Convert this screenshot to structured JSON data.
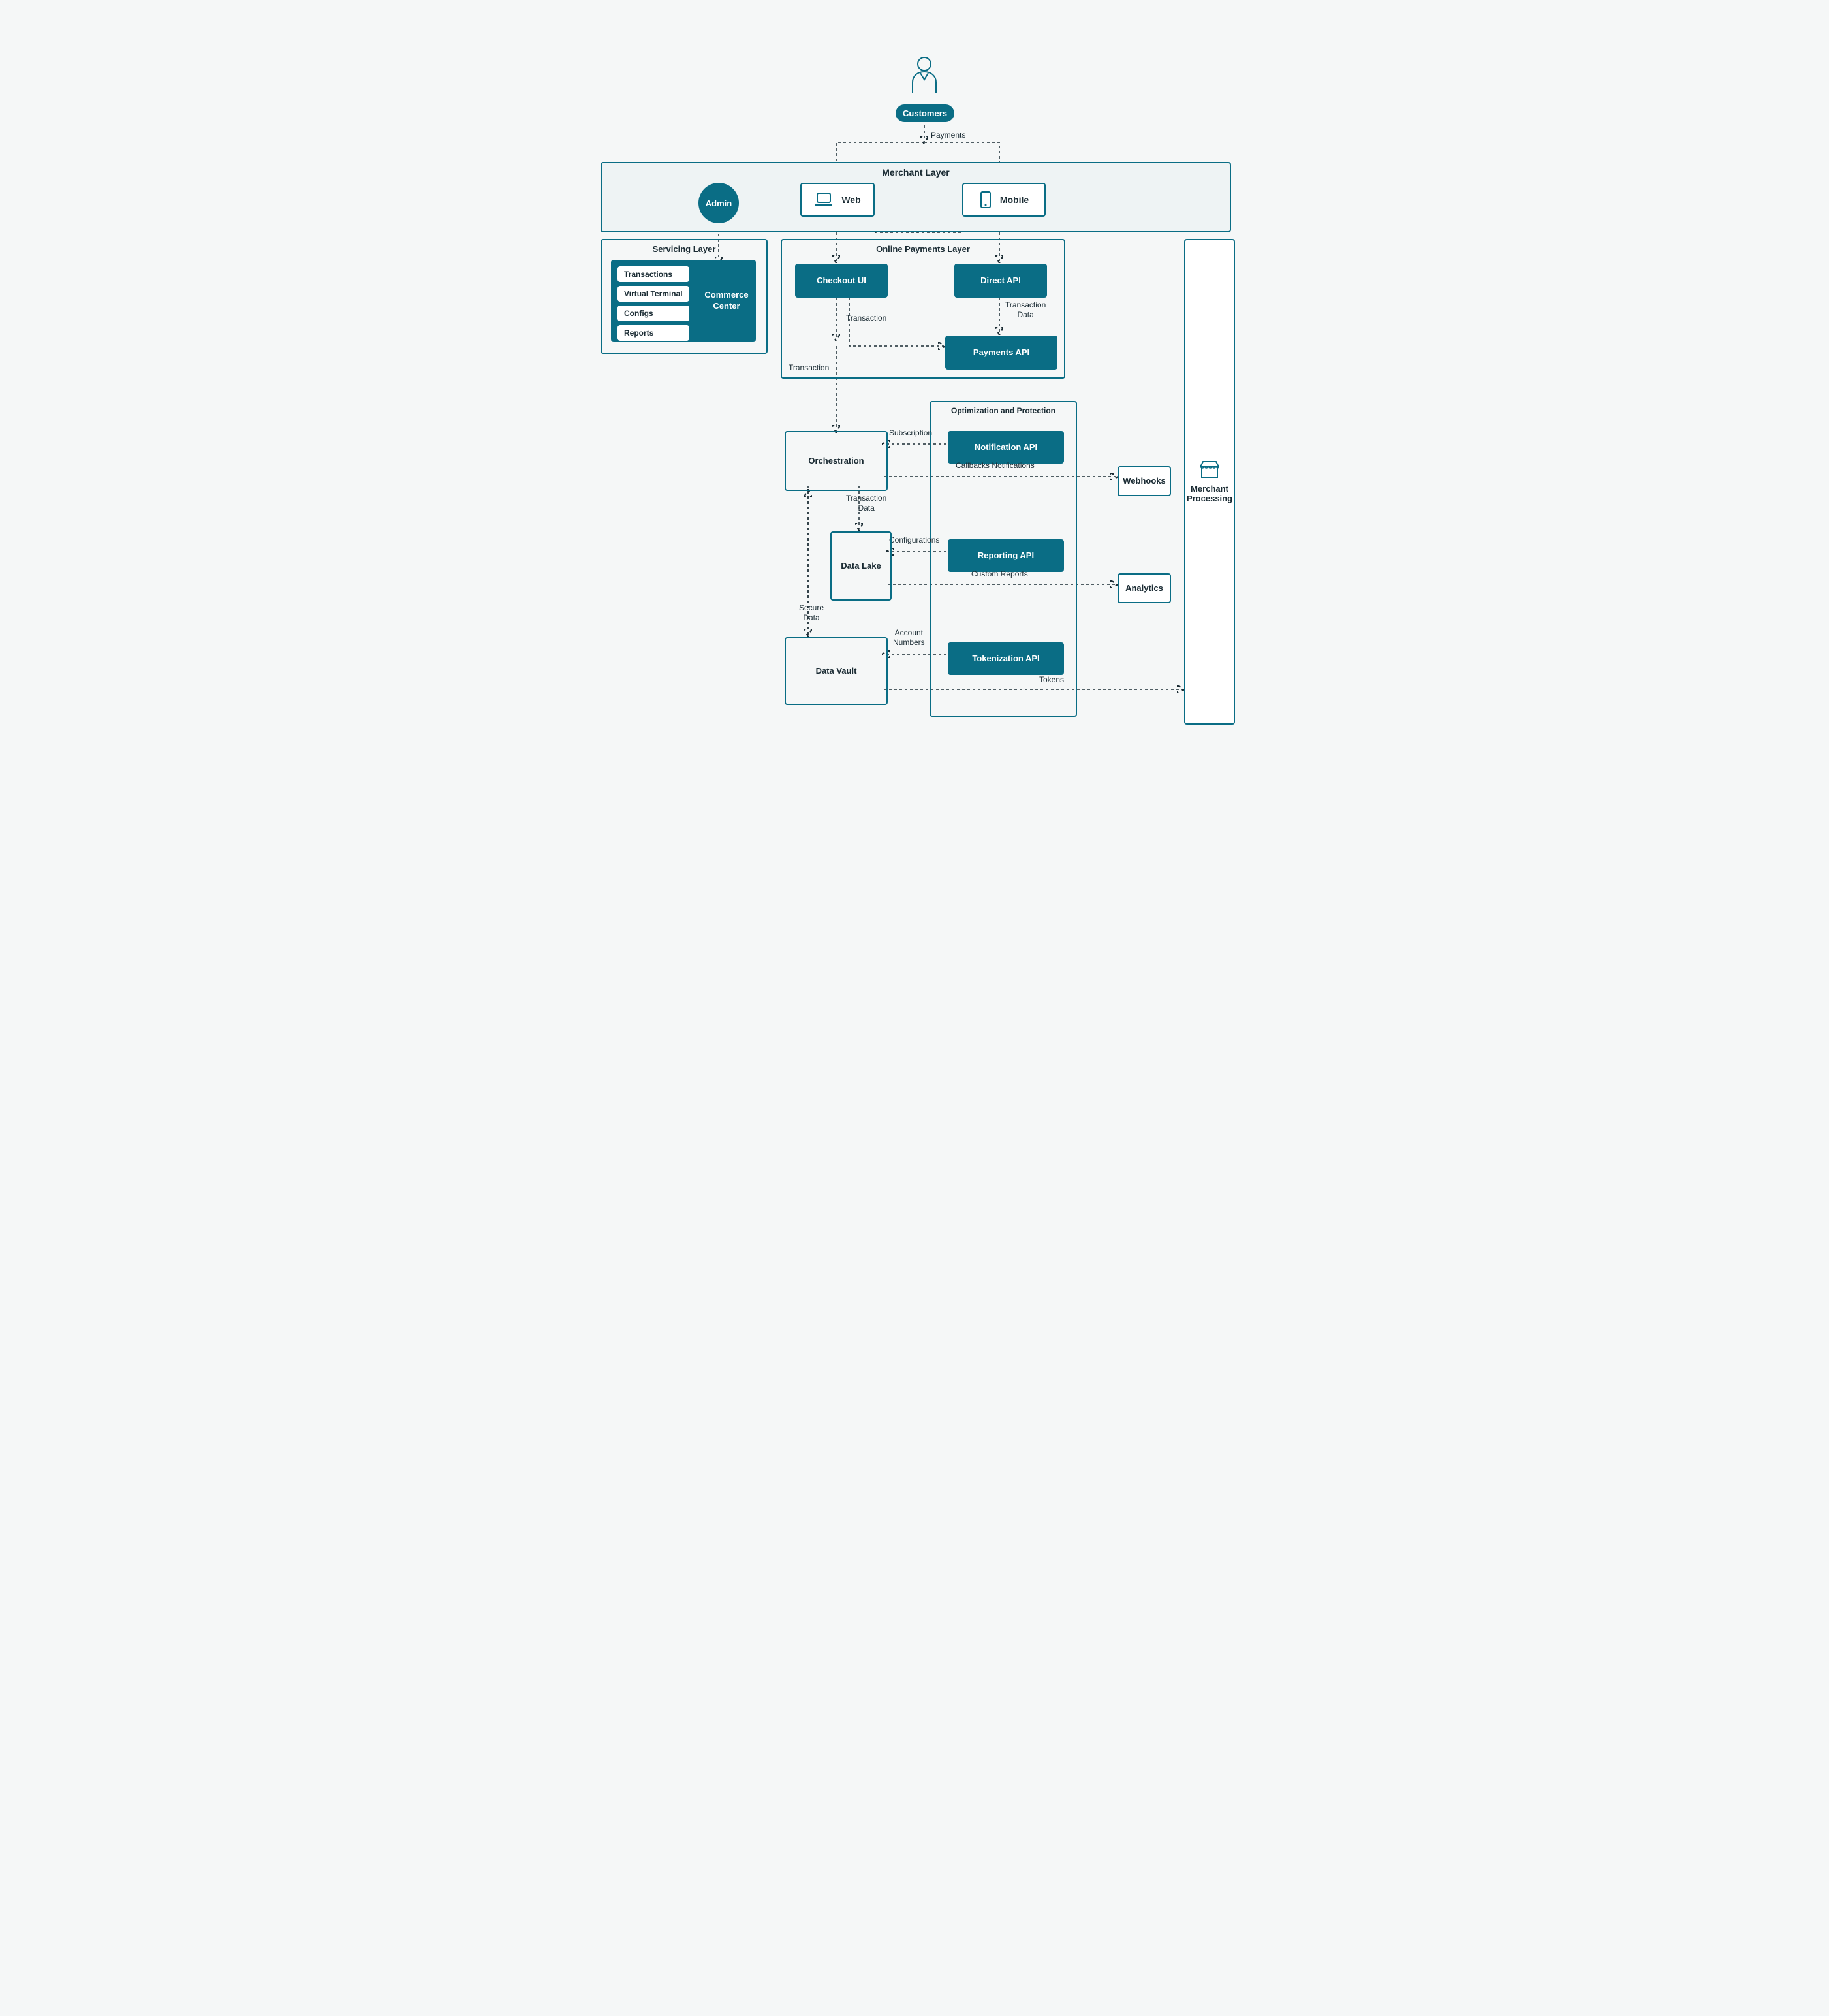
{
  "top": {
    "customers": "Customers",
    "payments_label": "Payments"
  },
  "merchant": {
    "title": "Merchant Layer",
    "web": "Web",
    "mobile": "Mobile",
    "admin": "Admin"
  },
  "servicing": {
    "title": "Servicing Layer",
    "commerce_center": "Commerce\nCenter",
    "items": [
      "Transactions",
      "Virtual Terminal",
      "Configs",
      "Reports"
    ]
  },
  "online": {
    "title": "Online Payments Layer",
    "checkout": "Checkout UI",
    "direct_api": "Direct API",
    "payments_api": "Payments API",
    "transaction": "Transaction",
    "transaction_data": "Transaction\nData",
    "transaction2": "Transaction"
  },
  "optprot": {
    "title": "Optimization and Protection",
    "notification": "Notification API",
    "reporting": "Reporting API",
    "tokenization": "Tokenization API",
    "subscription": "Subscription",
    "callbacks": "Callbacks Notifications",
    "configurations": "Configurations",
    "custom_reports": "Custom Reports",
    "account_numbers": "Account\nNumbers",
    "tokens": "Tokens"
  },
  "mid": {
    "orchestration": "Orchestration",
    "data_lake": "Data Lake",
    "data_vault": "Data Vault",
    "transaction_data": "Transaction\nData",
    "secure_data": "Secure\nData"
  },
  "right": {
    "webhooks": "Webhooks",
    "analytics": "Analytics",
    "merchant_processing": "Merchant\nProcessing"
  },
  "colors": {
    "brand": "#0a6d85",
    "text": "#1a2b33",
    "bg": "#f5f7f7"
  }
}
